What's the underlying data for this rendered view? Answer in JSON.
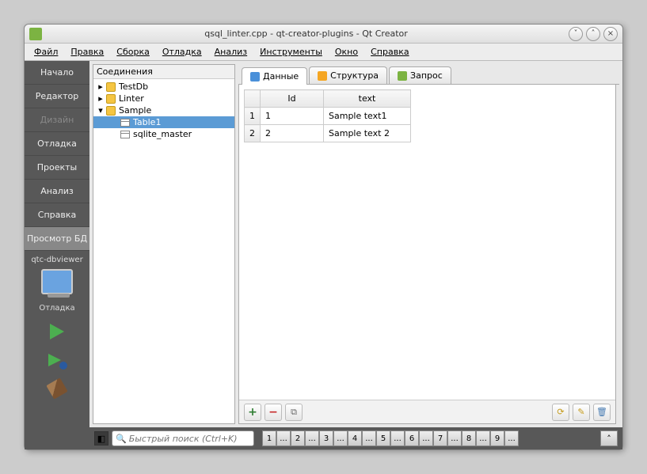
{
  "window": {
    "title": "qsql_linter.cpp - qt-creator-plugins - Qt Creator"
  },
  "menu": {
    "file": "Файл",
    "edit": "Правка",
    "build": "Сборка",
    "debug": "Отладка",
    "analyze": "Анализ",
    "tools": "Инструменты",
    "window": "Окно",
    "help": "Справка"
  },
  "rail": {
    "start": "Начало",
    "editor": "Редактор",
    "design": "Дизайн",
    "debug": "Отладка",
    "projects": "Проекты",
    "analyze": "Анализ",
    "help": "Справка",
    "dbview": "Просмотр БД",
    "kit": "qtc-dbviewer",
    "run_mode": "Отладка"
  },
  "tree": {
    "title": "Соединения",
    "items": [
      {
        "name": "TestDb",
        "expanded": false
      },
      {
        "name": "Linter",
        "expanded": false
      },
      {
        "name": "Sample",
        "expanded": true,
        "children": [
          {
            "name": "Table1",
            "selected": true
          },
          {
            "name": "sqlite_master"
          }
        ]
      }
    ]
  },
  "tabs": {
    "data": "Данные",
    "structure": "Структура",
    "query": "Запрос"
  },
  "grid": {
    "columns": [
      "Id",
      "text"
    ],
    "rows": [
      {
        "n": "1",
        "id": "1",
        "text": "Sample text1"
      },
      {
        "n": "2",
        "id": "2",
        "text": "Sample text 2"
      }
    ]
  },
  "search": {
    "placeholder": "Быстрый поиск (Ctrl+K)"
  },
  "locators": [
    "1",
    "...",
    "2",
    "...",
    "3",
    "...",
    "4",
    "...",
    "5",
    "...",
    "6",
    "...",
    "7",
    "...",
    "8",
    "...",
    "9",
    "..."
  ]
}
